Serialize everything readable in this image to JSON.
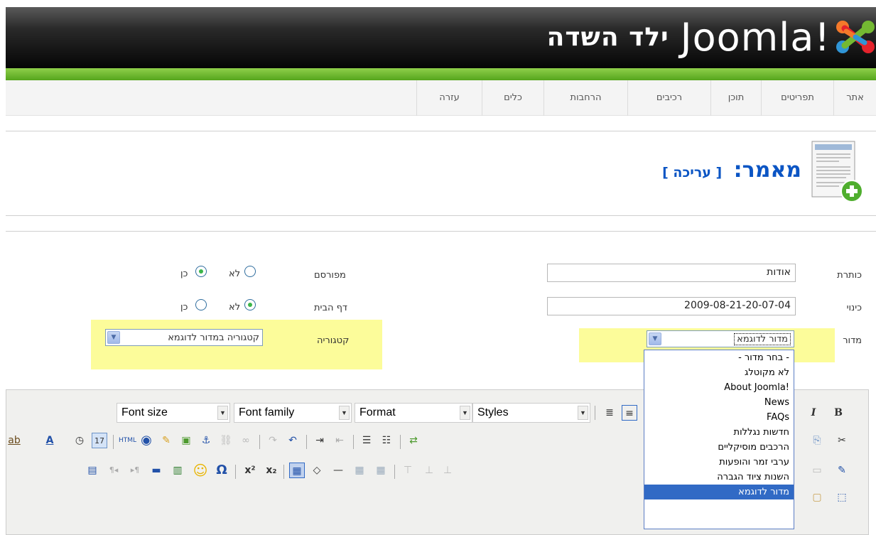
{
  "header": {
    "site_name": "ילד השדה",
    "logo_text": "Joomla!"
  },
  "menu": {
    "items": [
      "אתר",
      "תפריטים",
      "תוכן",
      "רכיבים",
      "הרחבות",
      "כלים",
      "עזרה"
    ]
  },
  "page": {
    "title": "מאמר:",
    "subtitle": "[ עריכה ]"
  },
  "form": {
    "title_label": "כותרת",
    "title_value": "אודות",
    "alias_label": "כינוי",
    "alias_value": "2009-08-21-20-07-04",
    "section_label": "מדור",
    "section_value": "מדור לדוגמא",
    "published_label": "מפורסם",
    "frontpage_label": "דף הבית",
    "category_label": "קטגוריה",
    "category_value": "קטגוריה במדור לדוגמא",
    "yes": "כן",
    "no": "לא",
    "published_selected": "yes",
    "frontpage_selected": "no"
  },
  "editor": {
    "font_size": "Font size",
    "font_family": "Font family",
    "format": "Format",
    "styles": "Styles"
  },
  "section_dropdown": {
    "options": [
      "- בחר מדור -",
      "לא מקוטלג",
      "About Joomla!",
      "News",
      "FAQs",
      "חדשות נגללות",
      "הרכבים מוסיקליים",
      "ערבי זמר והופעות",
      "השנות ציוד הגברה",
      "מדור לדוגמא"
    ],
    "selected_index": 9
  },
  "colors": {
    "accent_green": "#6cbf2c",
    "title_blue": "#0b55c4",
    "highlight_yellow": "#fcfc9a",
    "selection_blue": "#316ac5"
  }
}
